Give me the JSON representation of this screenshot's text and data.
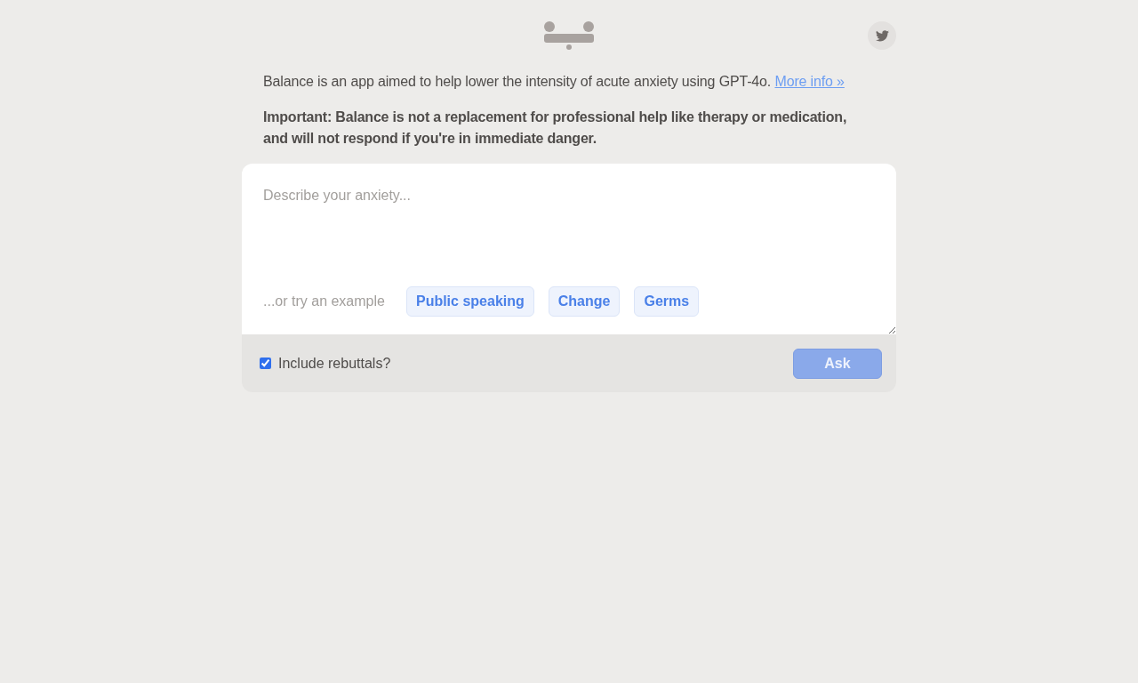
{
  "intro": {
    "text": "Balance is an app aimed to help lower the intensity of acute anxiety using GPT-4o.",
    "link": "More info »"
  },
  "notice": "Important: Balance is not a replacement for professional help like therapy or medication, and will not respond if you're in immediate danger.",
  "prompt": {
    "placeholder": "Describe your anxiety..."
  },
  "examples": {
    "label": "...or try an example",
    "items": [
      "Public speaking",
      "Change",
      "Germs"
    ]
  },
  "options": [
    {
      "label": "Include rebuttals?",
      "checked": true
    }
  ],
  "ask_button": {
    "label": "Ask",
    "disabled": true
  }
}
